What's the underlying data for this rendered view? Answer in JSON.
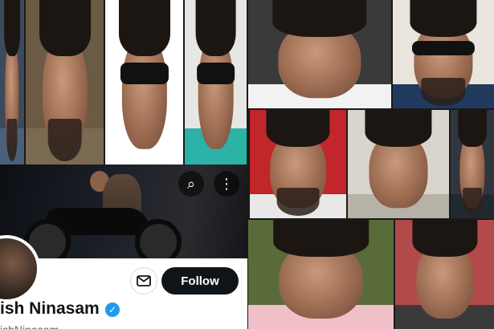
{
  "collage": {
    "tiles": [
      {
        "name": "portrait-1",
        "bg": "#3c4a5c",
        "shirt": "#4a5f7a",
        "beard": true
      },
      {
        "name": "portrait-2",
        "bg": "#6b5a44",
        "shirt": "#7a6a52",
        "beard": true
      },
      {
        "name": "portrait-3",
        "bg": "#ffffff",
        "shirt": "#ffffff",
        "shades": true
      },
      {
        "name": "portrait-4",
        "bg": "#e8e6e2",
        "shirt": "#2bb3a8",
        "shades": true
      },
      {
        "name": "portrait-5",
        "bg": "#3a3a3a",
        "shirt": "#f2f2f2"
      },
      {
        "name": "portrait-6",
        "bg": "#e9e4dc",
        "shirt": "#1f3a5c",
        "shades": true,
        "beard": true
      },
      {
        "name": "portrait-7",
        "bg": "#c0262a",
        "shirt": "#e8e8e8",
        "beard": true
      },
      {
        "name": "portrait-8",
        "bg": "#d9d4cc",
        "shirt": "#b7b2a8"
      },
      {
        "name": "portrait-9",
        "bg": "#2f3640",
        "shirt": "#202830",
        "beard": true
      },
      {
        "name": "portrait-10",
        "bg": "#5a6b3a",
        "shirt": "#f0c0c8"
      },
      {
        "name": "portrait-11",
        "bg": "#b24a4a",
        "shirt": "#3a3a3a"
      }
    ]
  },
  "profile": {
    "display_name": "ish Ninasam",
    "handle": "ishNinasam",
    "follow_label": "Follow",
    "search_icon": "⌕",
    "more_icon": "⋮",
    "verified_glyph": "✓",
    "colors": {
      "follow_bg": "#0f1419",
      "verified": "#1d9bf0",
      "handle": "#536471"
    }
  }
}
